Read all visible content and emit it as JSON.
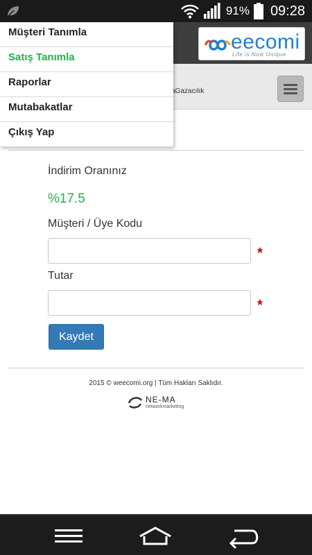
{
  "status_bar": {
    "battery_percent": "91%",
    "time": "09:28"
  },
  "header": {
    "logo_text": "eecomi",
    "logo_tagline": "Life is Now Unique",
    "sub_title": "aGazacılık"
  },
  "menu": {
    "items": [
      {
        "label": "Müşteri Tanımla",
        "active": false
      },
      {
        "label": "Satış Tanımla",
        "active": true
      },
      {
        "label": "Raporlar",
        "active": false
      },
      {
        "label": "Mutabakatlar",
        "active": false
      },
      {
        "label": "Çıkış Yap",
        "active": false
      }
    ]
  },
  "form": {
    "discount_label": "İndirim Oranınız",
    "discount_value": "%17.5",
    "member_code_label": "Müşteri / Üye Kodu",
    "member_code_value": "",
    "amount_label": "Tutar",
    "amount_value": "",
    "required_mark": "*",
    "save_label": "Kaydet"
  },
  "footer": {
    "copyright": "2015 © weecomi.org | Tüm Hakları Saklıdır.",
    "partner_logo": "NE-MA",
    "partner_sub": "networkmarketing"
  },
  "colors": {
    "accent_green": "#22b14c",
    "button_blue": "#337ab7",
    "required_red": "#cc0000"
  }
}
